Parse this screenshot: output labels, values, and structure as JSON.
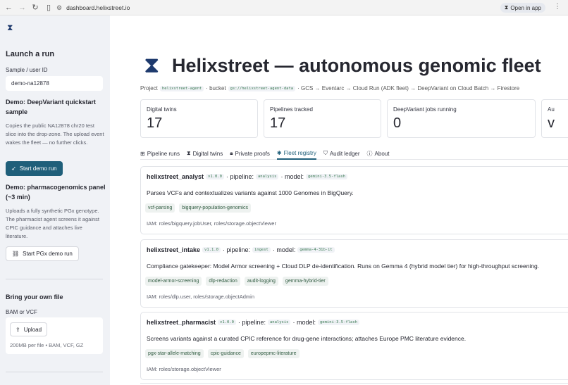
{
  "browser": {
    "url": "dashboard.helixstreet.io",
    "open_in_app": "Open in app"
  },
  "sidebar": {
    "logo_icon": "hourglass-icon",
    "launch_heading": "Launch a run",
    "sample_label": "Sample / user ID",
    "sample_value": "demo-na12878",
    "demo1_heading": "Demo: DeepVariant quickstart sample",
    "demo1_text": "Copies the public NA12878 chr20 test slice into the drop-zone. The upload event wakes the fleet — no further clicks.",
    "demo1_button": "Start demo run",
    "demo2_heading": "Demo: pharmacogenomics panel (~3 min)",
    "demo2_text": "Uploads a fully synthetic PGx genotype. The pharmacist agent screens it against CPIC guidance and attaches live literature.",
    "demo2_button": "Start PGx demo run",
    "byof_heading": "Bring your own file",
    "file_label": "BAM or VCF",
    "upload_button": "Upload",
    "upload_hint": "200MB per file • BAM, VCF, GZ"
  },
  "header": {
    "title": "Helixstreet — autonomous genomic fleet",
    "project_label": "Project",
    "project_id": "helixstreet-agent",
    "bucket_label": "· bucket",
    "bucket_id": "gs://helixstreet-agent-data",
    "pipeline_flow": "· GCS → Eventarc → Cloud Run (ADK fleet) → DeepVariant on Cloud Batch → Firestore"
  },
  "metrics": [
    {
      "label": "Digital twins",
      "value": "17"
    },
    {
      "label": "Pipelines tracked",
      "value": "17"
    },
    {
      "label": "DeepVariant jobs running",
      "value": "0"
    },
    {
      "label": "Au",
      "value": "v"
    }
  ],
  "tabs": [
    {
      "label": "Pipeline runs",
      "icon": "grid-icon"
    },
    {
      "label": "Digital twins",
      "icon": "hourglass-icon"
    },
    {
      "label": "Private proofs",
      "icon": "lock-icon"
    },
    {
      "label": "Fleet registry",
      "icon": "network-icon",
      "active": true
    },
    {
      "label": "Audit ledger",
      "icon": "shield-icon"
    },
    {
      "label": "About",
      "icon": "info-icon"
    }
  ],
  "agents": [
    {
      "name": "helixstreet_analyst",
      "version": "v1.0.0",
      "pipeline_label": "· pipeline:",
      "pipeline": "analysis",
      "model_label": "· model:",
      "model": "gemini-3.5-flash",
      "description": "Parses VCFs and contextualizes variants against 1000 Genomes in BigQuery.",
      "tags": [
        "vcf-parsing",
        "bigquery-population-genomics"
      ],
      "iam": "IAM: roles/bigquery.jobUser, roles/storage.objectViewer"
    },
    {
      "name": "helixstreet_intake",
      "version": "v1.1.0",
      "pipeline_label": "· pipeline:",
      "pipeline": "ingest",
      "model_label": "· model:",
      "model": "gemma-4-31b-it",
      "description": "Compliance gatekeeper: Model Armor screening + Cloud DLP de-identification. Runs on Gemma 4 (hybrid model tier) for high-throughput screening.",
      "tags": [
        "model-armor-screening",
        "dlp-redaction",
        "audit-logging",
        "gemma-hybrid-tier"
      ],
      "iam": "IAM: roles/dlp.user, roles/storage.objectAdmin"
    },
    {
      "name": "helixstreet_pharmacist",
      "version": "v1.0.0",
      "pipeline_label": "· pipeline:",
      "pipeline": "analysis",
      "model_label": "· model:",
      "model": "gemini-3.5-flash",
      "description": "Screens variants against a curated CPIC reference for drug-gene interactions; attaches Europe PMC literature evidence.",
      "tags": [
        "pgx-star-allele-matching",
        "cpic-guidance",
        "europepmc-literature"
      ],
      "iam": "IAM: roles/storage.objectViewer"
    }
  ],
  "colors": {
    "accent": "#1f5f7a",
    "sidebar_bg": "#f0f2f6",
    "tag_text": "#2e5a3f"
  }
}
